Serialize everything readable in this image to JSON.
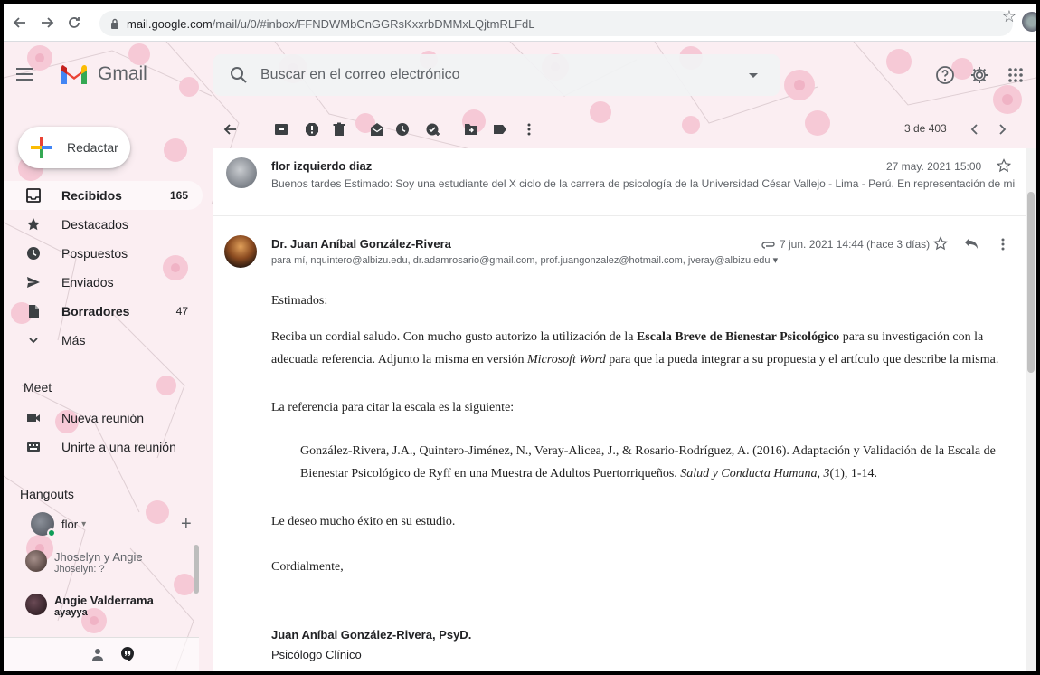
{
  "browser": {
    "url_host": "mail.google.com",
    "url_path": "/mail/u/0/#inbox/FFNDWMbCnGGRsKxxrbDMMxLQjtmRLFdL"
  },
  "app": {
    "name": "Gmail",
    "search_placeholder": "Buscar en el correo electrónico"
  },
  "compose_label": "Redactar",
  "sidebar": {
    "items": [
      {
        "label": "Recibidos",
        "count": "165",
        "icon": "inbox-icon"
      },
      {
        "label": "Destacados",
        "count": "",
        "icon": "star-icon"
      },
      {
        "label": "Pospuestos",
        "count": "",
        "icon": "clock-icon"
      },
      {
        "label": "Enviados",
        "count": "",
        "icon": "send-icon"
      },
      {
        "label": "Borradores",
        "count": "47",
        "icon": "draft-icon"
      },
      {
        "label": "Más",
        "count": "",
        "icon": "chevron-down-icon"
      }
    ],
    "meet_title": "Meet",
    "meet_items": [
      {
        "label": "Nueva reunión",
        "icon": "video-icon"
      },
      {
        "label": "Unirte a una reunión",
        "icon": "keyboard-icon"
      }
    ],
    "hangouts_title": "Hangouts",
    "hangouts_user": "flor",
    "hangouts": [
      {
        "name": "Jhoselyn y Angie",
        "sub": "Jhoselyn: ?"
      },
      {
        "name": "Angie Valderrama",
        "sub": "ayayya"
      }
    ]
  },
  "toolbar": {
    "pager": "3 de 403"
  },
  "thread": {
    "first_message": {
      "sender": "flor izquierdo diaz",
      "date": "27 may. 2021 15:00",
      "snippet": "Buenos tardes Estimado: Soy una estudiante del X ciclo de la carrera de psicología de la Universidad César Vallejo - Lima - Perú. En representación de mi e..."
    },
    "second_message": {
      "sender": "Dr. Juan Aníbal González-Rivera",
      "date": "7 jun. 2021 14:44 (hace 3 días)",
      "recipients": "para mí, nquintero@albizu.edu, dr.adamrosario@gmail.com, prof.juangonzalez@hotmail.com, jveray@albizu.edu",
      "greeting": "Estimados:",
      "p1_a": "Reciba un cordial saludo. Con mucho gusto autorizo la utilización de la ",
      "p1_b": "Escala Breve de Bienestar Psicológico",
      "p1_c": " para su investigación con la",
      "p1_d": "adecuada referencia. Adjunto la misma en versión ",
      "p1_e": "Microsoft Word",
      "p1_f": " para que la pueda integrar a su propuesta y el artículo que describe la misma.",
      "p2": "La referencia para citar la escala es la siguiente:",
      "ref_a": "González-Rivera, J.A., Quintero-Jiménez, N., Veray-Alicea, J., & Rosario-Rodríguez, A. (2016). Adaptación y Validación de la Escala de",
      "ref_b": "Bienestar Psicológico de Ryff en una Muestra de Adultos Puertorriqueños. ",
      "ref_c": "Salud y Conducta Humana, 3",
      "ref_d": "(1), 1-14.",
      "p3": "Le deseo mucho éxito en su estudio.",
      "closing": "Cordialmente,",
      "sig_name": "Juan Aníbal González-Rivera, PsyD.",
      "sig_title": "Psicólogo Clínico"
    }
  },
  "colors": {
    "gmail_red": "#ea4335",
    "blossom": "#f6c9d6",
    "background": "#fbeef2"
  }
}
